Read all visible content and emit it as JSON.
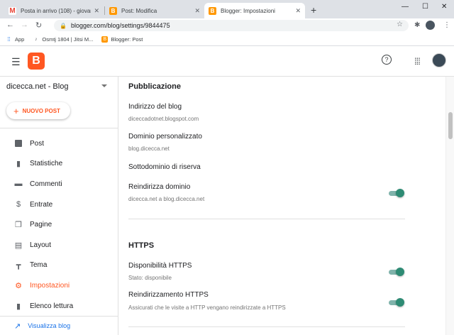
{
  "browser": {
    "tabs": [
      {
        "title": "Posta in arrivo (108) - giovanni.d",
        "icon": "gmail-icon",
        "color": "#ea4335"
      },
      {
        "title": "Post: Modifica",
        "icon": "blogger-icon",
        "color": "#ff9800"
      },
      {
        "title": "Blogger: Impostazioni",
        "icon": "blogger-icon",
        "color": "#ff9800"
      }
    ],
    "url": "blogger.com/blog/settings/9844475",
    "bookmarks": [
      {
        "label": "App",
        "icon": "apps-grid-icon"
      },
      {
        "label": "Osmtj 1804 | Jitsi M...",
        "icon": "jitsi-icon"
      },
      {
        "label": "Blogger: Post",
        "icon": "blogger-icon"
      }
    ]
  },
  "header": {
    "logo_letter": "B"
  },
  "sidebar": {
    "blog_name": "dicecca.net - Blog",
    "new_post_label": "NUOVO POST",
    "items": [
      {
        "label": "Post",
        "icon": "post-icon"
      },
      {
        "label": "Statistiche",
        "icon": "stats-icon"
      },
      {
        "label": "Commenti",
        "icon": "comments-icon"
      },
      {
        "label": "Entrate",
        "icon": "dollar-icon"
      },
      {
        "label": "Pagine",
        "icon": "pages-icon"
      },
      {
        "label": "Layout",
        "icon": "layout-icon"
      },
      {
        "label": "Tema",
        "icon": "paint-roller-icon"
      },
      {
        "label": "Impostazioni",
        "icon": "gear-icon",
        "active": true
      },
      {
        "label": "Elenco lettura",
        "icon": "bookmark-icon"
      }
    ],
    "view_blog_label": "Visualizza blog"
  },
  "main": {
    "publishing": {
      "title": "Pubblicazione",
      "blog_address_label": "Indirizzo del blog",
      "blog_address_value": "diceccadotnet.blogspot.com",
      "custom_domain_label": "Dominio personalizzato",
      "custom_domain_value": "blog.dicecca.net",
      "fallback_subdomain_label": "Sottodominio di riserva",
      "redirect_domain_label": "Reindirizza dominio",
      "redirect_domain_desc": "dicecca.net a blog.dicecca.net",
      "redirect_domain_on": true
    },
    "https": {
      "title": "HTTPS",
      "availability_label": "Disponibilità HTTPS",
      "availability_desc": "Stato: disponibile",
      "availability_on": true,
      "redirect_label": "Reindirizzamento HTTPS",
      "redirect_desc": "Assicurati che le visite a HTTP vengano reindirizzate a HTTPS",
      "redirect_on": true
    }
  },
  "colors": {
    "accent": "#ff5722",
    "toggle_on": "#2e8b74",
    "link": "#1a73e8"
  }
}
